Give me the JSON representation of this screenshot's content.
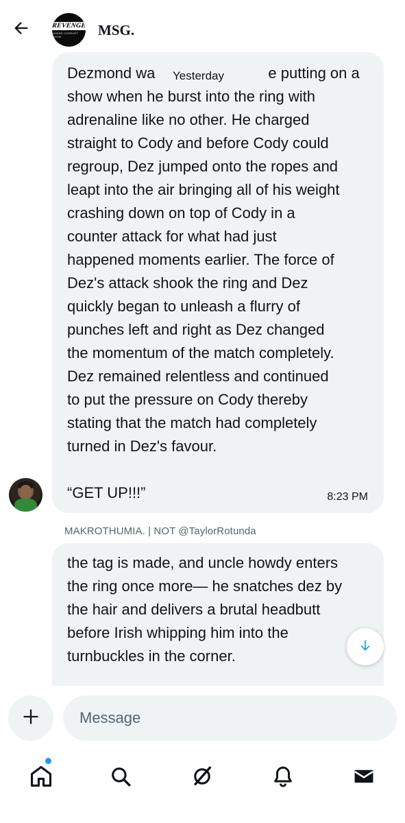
{
  "header": {
    "back_icon": "arrow-left-icon",
    "group_avatar": {
      "logo_text": "REVENGE",
      "logo_subtext": "WHERE CORRUPT ROOM"
    },
    "group_name": "MSG."
  },
  "conversation": {
    "day_divider": "Yesterday",
    "messages": [
      {
        "text": "Dezmond wa                           e putting on a\nshow when he burst into the ring with\nadrenaline like no other. He charged\nstraight to Cody and before Cody could\nregroup, Dez jumped onto the ropes and\nleapt into the air bringing all of his weight\ncrashing down on top of Cody in a\ncounter attack for what had just\nhappened moments earlier. The force of\nDez's attack shook the ring and Dez\nquickly began to unleash a flurry of\npunches left and right as Dez changed\nthe momentum of the match completely.\nDez remained relentless and continued\nto put the pressure on Cody thereby\nstating that the match had completely\nturned in Dez's favour.\n\n“GET UP!!!”",
        "time": "8:23 PM"
      },
      {
        "sender": "MAKROTHUMIA. | NOT @TaylorRotunda",
        "text": "the tag is made, and uncle howdy enters\nthe ring once more— he snatches dez by\nthe hair and delivers a brutal headbutt\nbefore Irish whipping him into the\nturnbuckles in the corner."
      }
    ],
    "scroll_down_icon": "arrow-down-icon"
  },
  "composer": {
    "add_icon": "plus-icon",
    "placeholder": "Message",
    "value": ""
  },
  "bottom_nav": {
    "items": [
      {
        "icon": "home-icon",
        "active": true,
        "notification_dot": true
      },
      {
        "icon": "search-icon"
      },
      {
        "icon": "grok-icon"
      },
      {
        "icon": "bell-icon"
      },
      {
        "icon": "messages-icon",
        "active": true
      }
    ]
  },
  "colors": {
    "bubble_bg": "#eff3f4",
    "accent_blue": "#1d9bf0",
    "secondary_text": "#536471",
    "primary_text": "#0f1419"
  }
}
